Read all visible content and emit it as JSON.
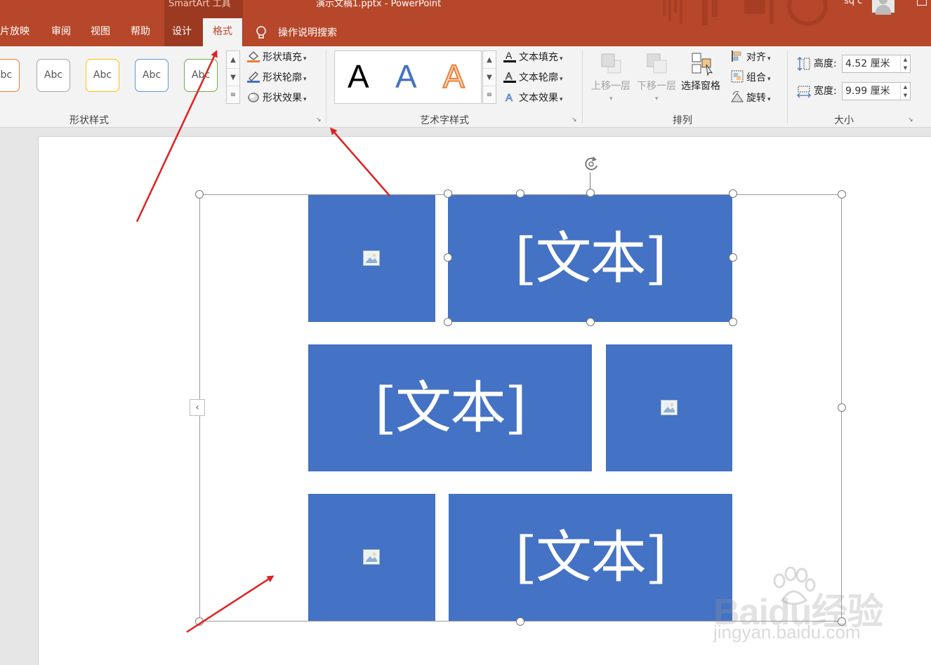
{
  "app": {
    "context_label": "SmartArt 工具",
    "document_title": "演示文稿1.pptx  -  PowerPoint",
    "user_name": "sq c"
  },
  "tabs": [
    {
      "label": "片放映"
    },
    {
      "label": "审阅"
    },
    {
      "label": "视图"
    },
    {
      "label": "帮助"
    },
    {
      "label": "设计"
    },
    {
      "label": "格式",
      "active": true
    }
  ],
  "tell_me": {
    "label": "操作说明搜索"
  },
  "ribbon": {
    "shape_styles": {
      "label": "形状样式",
      "presets": [
        {
          "text": "Abc",
          "border": "#ed7d31"
        },
        {
          "text": "Abc",
          "border": "#a5a5a5"
        },
        {
          "text": "Abc",
          "border": "#ffc000"
        },
        {
          "text": "Abc",
          "border": "#5b9bd5"
        },
        {
          "text": "Abc",
          "border": "#70ad47"
        }
      ],
      "fill": "形状填充",
      "outline": "形状轮廓",
      "effects": "形状效果"
    },
    "wordart_styles": {
      "label": "艺术字样式",
      "samples": [
        {
          "text": "A",
          "style": "black"
        },
        {
          "text": "A",
          "style": "blue"
        },
        {
          "text": "A",
          "style": "orange-outline"
        }
      ],
      "text_fill": "文本填充",
      "text_outline": "文本轮廓",
      "text_effects": "文本效果"
    },
    "arrange": {
      "label": "排列",
      "bring_forward": "上移一层",
      "send_backward": "下移一层",
      "selection_pane": "选择窗格",
      "align": "对齐",
      "group": "组合",
      "rotate": "旋转"
    },
    "size": {
      "label": "大小",
      "height_label": "高度:",
      "height_value": "4.52 厘米",
      "width_label": "宽度:",
      "width_value": "9.99 厘米"
    }
  },
  "slide": {
    "placeholder_text": "[文本]"
  },
  "watermark": {
    "logo": "Baidu经验",
    "url": "jingyan.baidu.com"
  },
  "colors": {
    "ribbon_red": "#b7472a",
    "shape_blue": "#4472c4",
    "arrow_red": "#e02020"
  }
}
